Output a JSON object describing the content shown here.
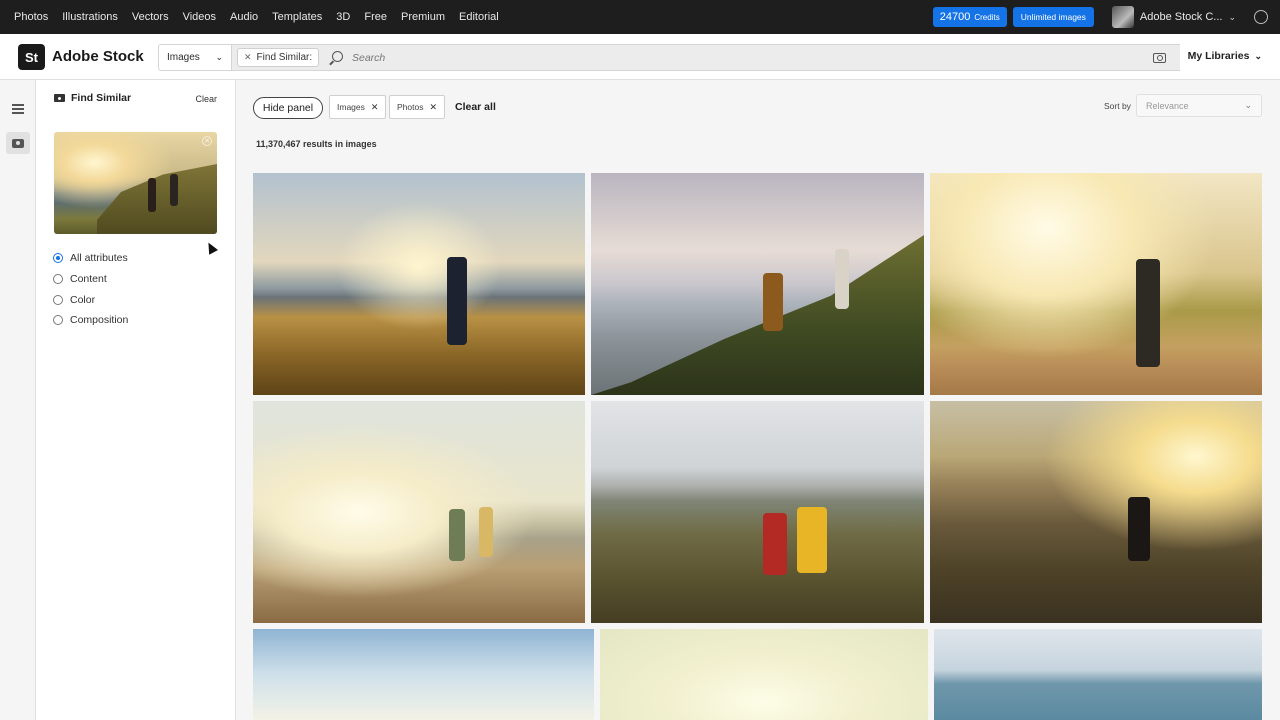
{
  "topnav": {
    "items": [
      "Photos",
      "Illustrations",
      "Vectors",
      "Videos",
      "Audio",
      "Templates",
      "3D",
      "Free",
      "Premium",
      "Editorial"
    ],
    "credits_count": "24700",
    "credits_label": "Credits",
    "unlimited_label": "Unlimited images",
    "account_label": "Adobe Stock C..."
  },
  "header": {
    "logo_mark": "St",
    "logo_text": "Adobe Stock",
    "asset_type": "Images",
    "find_similar_chip": "Find Similar:",
    "search_placeholder": "Search",
    "my_libraries": "My Libraries"
  },
  "panel": {
    "title": "Find Similar",
    "clear_label": "Clear",
    "options": [
      {
        "label": "All attributes",
        "selected": true
      },
      {
        "label": "Content",
        "selected": false
      },
      {
        "label": "Color",
        "selected": false
      },
      {
        "label": "Composition",
        "selected": false
      }
    ]
  },
  "filters": {
    "hide_panel": "Hide panel",
    "chips": [
      "Images",
      "Photos"
    ],
    "clear_all": "Clear all",
    "sort_by_label": "Sort by",
    "sort_value": "Relevance"
  },
  "results": {
    "count_text": "11,370,467 results in images"
  },
  "colors": {
    "accent": "#1473e6",
    "topbar_bg": "#1e1e1e"
  }
}
